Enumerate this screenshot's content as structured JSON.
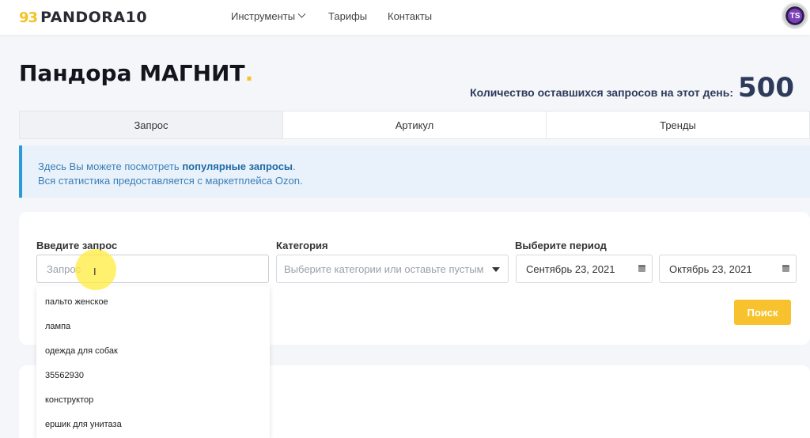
{
  "header": {
    "logo_mark": "93",
    "logo_text": "PANDORA10",
    "nav": [
      {
        "label": "Инструменты",
        "has_dropdown": true
      },
      {
        "label": "Тарифы"
      },
      {
        "label": "Контакты"
      }
    ],
    "avatar_initials": "TS"
  },
  "page": {
    "title": "Пандора МАГНИТ",
    "title_dot": ".",
    "quota_label": "Количество оставшихся запросов на этот день:",
    "quota_value": "500"
  },
  "tabs": [
    {
      "label": "Запрос",
      "active": true
    },
    {
      "label": "Артикул",
      "active": false
    },
    {
      "label": "Тренды",
      "active": false
    }
  ],
  "info": {
    "line1_prefix": "Здесь Вы можете посмотреть ",
    "line1_bold": "популярные запросы",
    "line1_suffix": ".",
    "line2": "Вся статистика предоставляется с маркетплейса Ozon."
  },
  "form": {
    "query_label": "Введите запрос",
    "query_placeholder": "Запрос",
    "query_value": "",
    "category_label": "Категория",
    "category_placeholder": "Выберите категории или оставьте пустым",
    "period_label": "Выберите период",
    "date_from": "Сентябрь 23, 2021",
    "date_to": "Октябрь 23, 2021",
    "search_button": "Поиск"
  },
  "suggestions": [
    "пальто женское",
    "лампа",
    "одежда для собак",
    "35562930",
    "конструктор",
    "ершик для унитаза"
  ],
  "colors": {
    "accent": "#f6c224",
    "info_border": "#2a9bd8",
    "quota_text": "#2e3a59"
  }
}
